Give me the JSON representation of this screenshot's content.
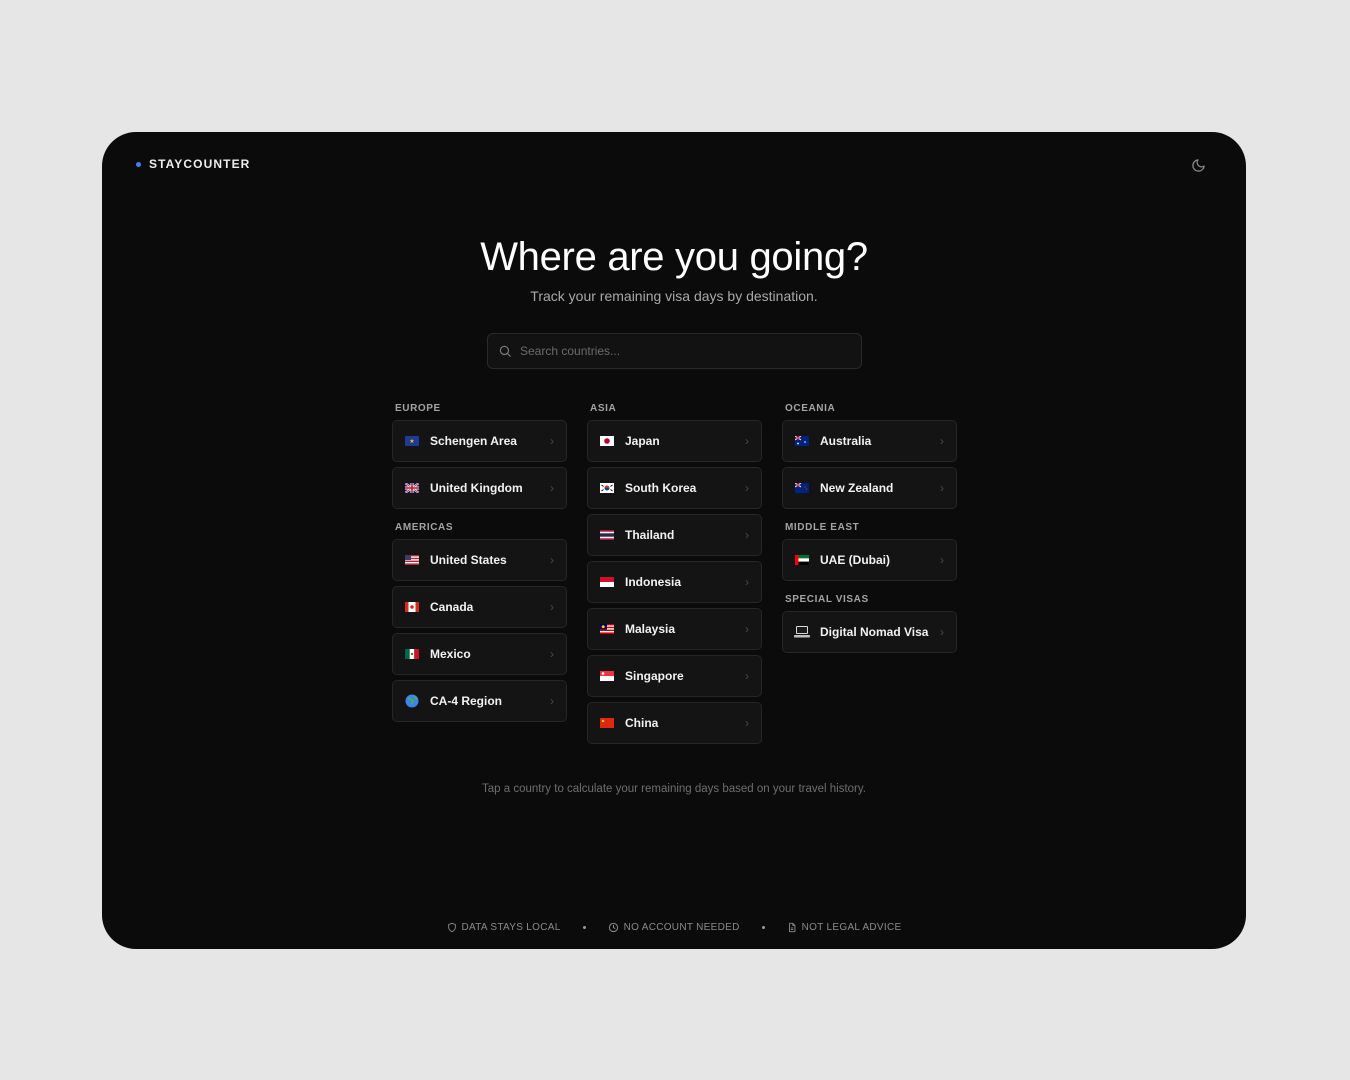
{
  "brand": {
    "name": "STAYCOUNTER",
    "accent": "#3b82f6"
  },
  "header": {
    "theme_icon": "moon-icon"
  },
  "hero": {
    "title": "Where are you going?",
    "subtitle": "Track your remaining visa days by destination."
  },
  "search": {
    "placeholder": "Search countries...",
    "value": ""
  },
  "groups": {
    "europe": {
      "label": "EUROPE",
      "items": [
        {
          "label": "Schengen Area",
          "flag": "eu-flag"
        },
        {
          "label": "United Kingdom",
          "flag": "uk-flag"
        }
      ]
    },
    "americas": {
      "label": "AMERICAS",
      "items": [
        {
          "label": "United States",
          "flag": "us-flag"
        },
        {
          "label": "Canada",
          "flag": "ca-flag"
        },
        {
          "label": "Mexico",
          "flag": "mx-flag"
        },
        {
          "label": "CA-4 Region",
          "flag": "globe-icon"
        }
      ]
    },
    "asia": {
      "label": "ASIA",
      "items": [
        {
          "label": "Japan",
          "flag": "jp-flag"
        },
        {
          "label": "South Korea",
          "flag": "kr-flag"
        },
        {
          "label": "Thailand",
          "flag": "th-flag"
        },
        {
          "label": "Indonesia",
          "flag": "id-flag"
        },
        {
          "label": "Malaysia",
          "flag": "my-flag"
        },
        {
          "label": "Singapore",
          "flag": "sg-flag"
        },
        {
          "label": "China",
          "flag": "cn-flag"
        }
      ]
    },
    "oceania": {
      "label": "OCEANIA",
      "items": [
        {
          "label": "Australia",
          "flag": "au-flag"
        },
        {
          "label": "New Zealand",
          "flag": "nz-flag"
        }
      ]
    },
    "middle_east": {
      "label": "MIDDLE EAST",
      "items": [
        {
          "label": "UAE (Dubai)",
          "flag": "ae-flag"
        }
      ]
    },
    "special": {
      "label": "SPECIAL VISAS",
      "items": [
        {
          "label": "Digital Nomad Visa",
          "flag": "laptop-icon"
        }
      ]
    }
  },
  "hint": "Tap a country to calculate your remaining days based on your travel history.",
  "footer": {
    "items": [
      {
        "label": "DATA STAYS LOCAL",
        "icon": "shield-icon"
      },
      {
        "label": "NO ACCOUNT NEEDED",
        "icon": "clock-icon"
      },
      {
        "label": "NOT LEGAL ADVICE",
        "icon": "document-icon"
      }
    ]
  }
}
